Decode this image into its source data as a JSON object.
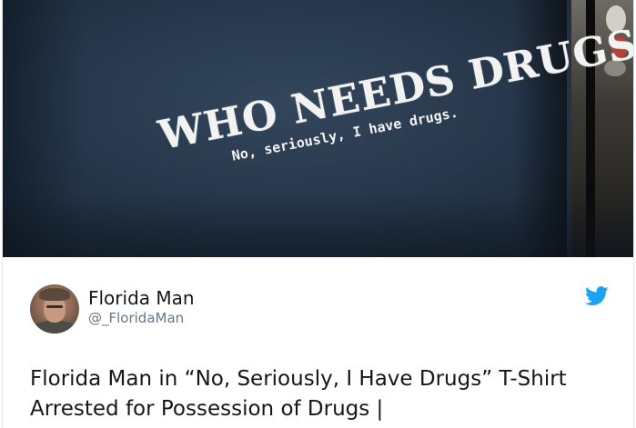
{
  "photo": {
    "shirt_headline": "WHO NEEDS DRUGS",
    "shirt_subline": "No, seriously, I have drugs."
  },
  "author": {
    "display_name": "Florida Man",
    "handle": "@_FloridaMan"
  },
  "icons": {
    "avatar": "avatar-photo",
    "platform": "twitter-bird-icon"
  },
  "tweet": {
    "line1": "Florida Man in “No, Seriously, I Have Drugs” T-Shirt",
    "line2": "Arrested for Possession of Drugs |"
  },
  "colors": {
    "twitter_blue": "#1da1f2",
    "shirt": "#2a3b4f",
    "text": "#14171a",
    "secondary_text": "#657786"
  }
}
